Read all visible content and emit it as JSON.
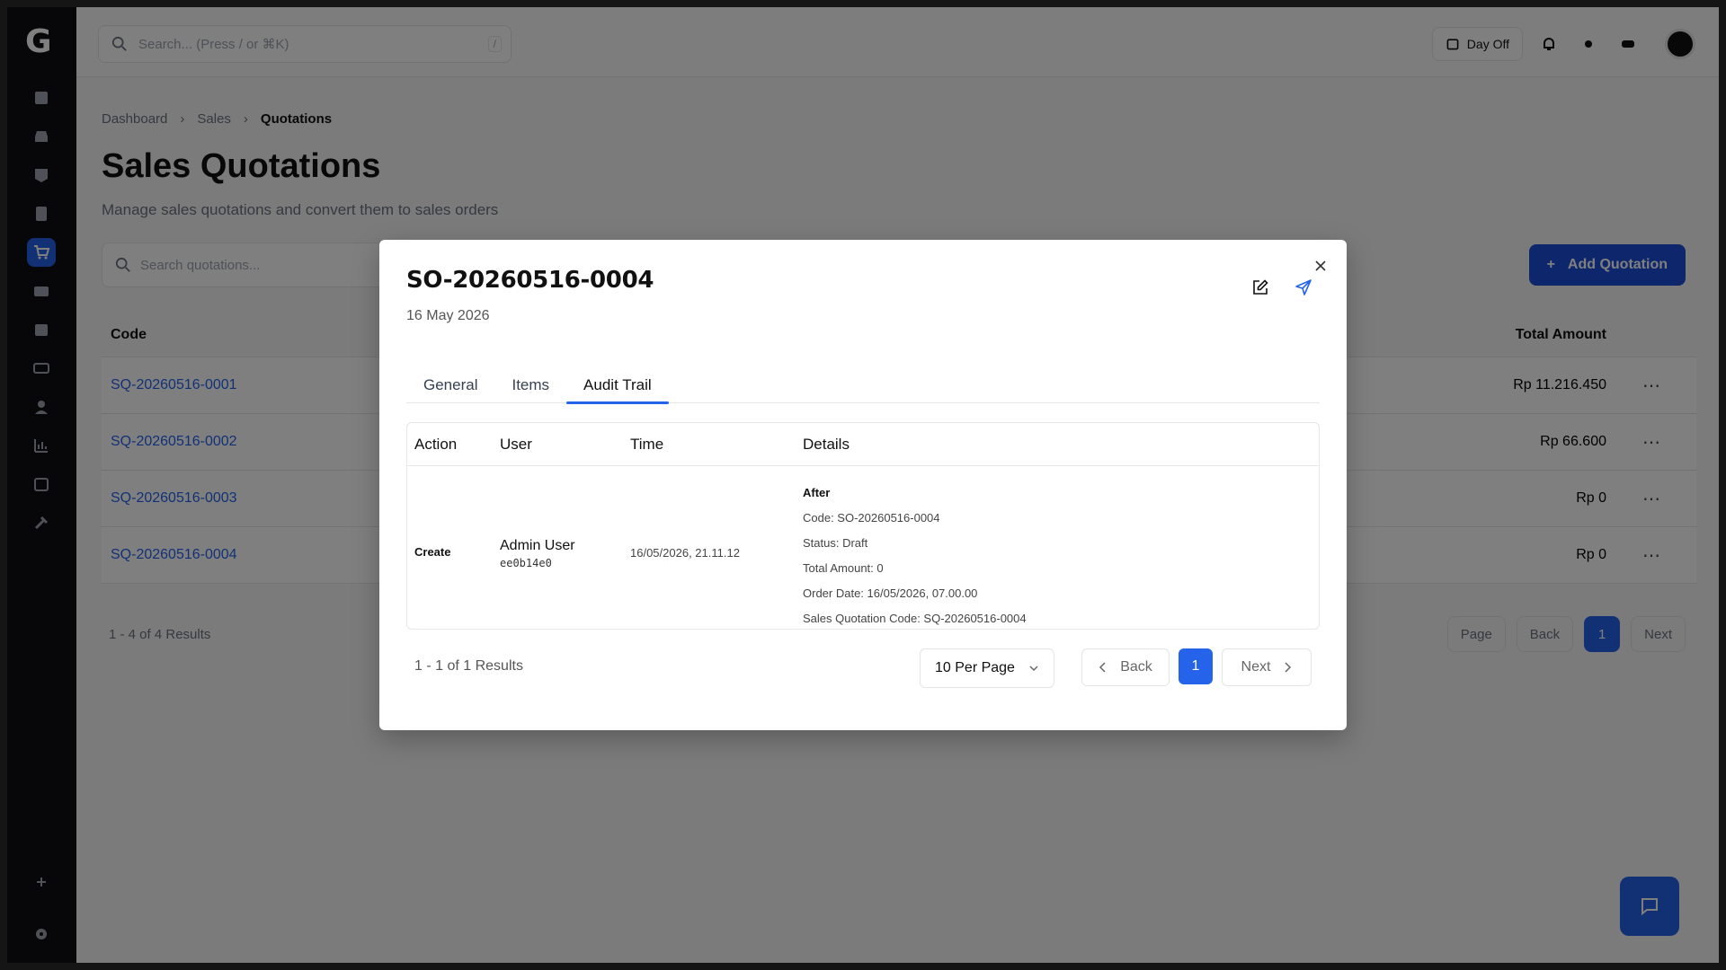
{
  "topbar": {
    "search_placeholder": "Search... (Press / or ⌘K)",
    "search_shortcut": "/",
    "day_off_label": "Day Off"
  },
  "breadcrumb": [
    "Dashboard",
    "Sales",
    "Quotations"
  ],
  "page": {
    "title": "Sales Quotations",
    "subtitle": "Manage sales quotations and convert them to sales orders",
    "search_placeholder": "Search quotations...",
    "add_button": "Add Quotation"
  },
  "list": {
    "columns": {
      "code": "Code",
      "total_amount": "Total Amount"
    },
    "rows": [
      {
        "code": "SQ-20260516-0001",
        "amount": "Rp 11.216.450"
      },
      {
        "code": "SQ-20260516-0002",
        "amount": "Rp 66.600"
      },
      {
        "code": "SQ-20260516-0003",
        "amount": "Rp 0"
      },
      {
        "code": "SQ-20260516-0004",
        "amount": "Rp 0"
      }
    ],
    "results": "1 - 4 of 4 Results",
    "per_page": "Page",
    "back": "Back",
    "page": "1",
    "next": "Next"
  },
  "modal": {
    "title": "SO-20260516-0004",
    "date": "16 May 2026",
    "tabs": [
      "General",
      "Items",
      "Audit Trail"
    ],
    "active_tab": "Audit Trail",
    "audit": {
      "columns": [
        "Action",
        "User",
        "Time",
        "Details"
      ],
      "rows": [
        {
          "action": "Create",
          "user": "Admin User",
          "user_id": "ee0b14e0",
          "time": "16/05/2026, 21.11.12",
          "details_heading": "After",
          "details": [
            "Code: SO-20260516-0004",
            "Status: Draft",
            "Total Amount: 0",
            "Order Date: 16/05/2026, 07.00.00",
            "Sales Quotation Code: SQ-20260516-0004"
          ]
        }
      ]
    },
    "results": "1 - 1 of 1 Results",
    "per_page": "10 Per Page",
    "back": "Back",
    "page": "1",
    "next": "Next"
  },
  "colors": {
    "accent": "#2563eb",
    "sidebar_bg": "#0f0f12"
  }
}
